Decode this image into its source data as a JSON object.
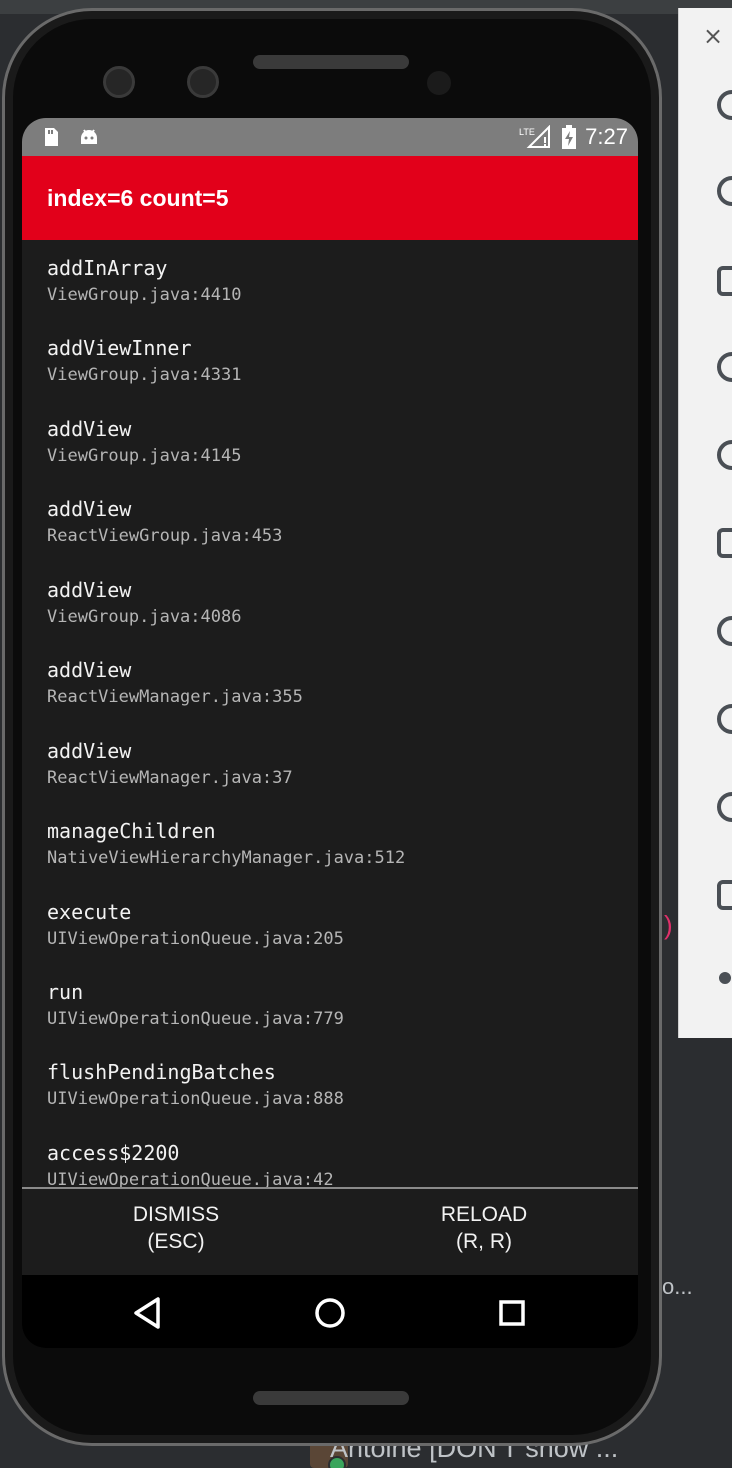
{
  "status_bar": {
    "network_label": "LTE",
    "time": "7:27"
  },
  "redbox": {
    "title": "index=6 count=5",
    "background_color": "#e2001a"
  },
  "stack_frames": [
    {
      "method": "addInArray",
      "file": "ViewGroup.java:4410"
    },
    {
      "method": "addViewInner",
      "file": "ViewGroup.java:4331"
    },
    {
      "method": "addView",
      "file": "ViewGroup.java:4145"
    },
    {
      "method": "addView",
      "file": "ReactViewGroup.java:453"
    },
    {
      "method": "addView",
      "file": "ViewGroup.java:4086"
    },
    {
      "method": "addView",
      "file": "ReactViewManager.java:355"
    },
    {
      "method": "addView",
      "file": "ReactViewManager.java:37"
    },
    {
      "method": "manageChildren",
      "file": "NativeViewHierarchyManager.java:512"
    },
    {
      "method": "execute",
      "file": "UIViewOperationQueue.java:205"
    },
    {
      "method": "run",
      "file": "UIViewOperationQueue.java:779"
    },
    {
      "method": "flushPendingBatches",
      "file": "UIViewOperationQueue.java:888"
    },
    {
      "method": "access$2200",
      "file": "UIViewOperationQueue.java:42"
    }
  ],
  "footer": {
    "dismiss_label": "DISMISS",
    "dismiss_shortcut": "(ESC)",
    "reload_label": "RELOAD",
    "reload_shortcut": "(R, R)"
  },
  "nav_bar": {
    "back_icon": "back-triangle-icon",
    "home_icon": "home-circle-icon",
    "recents_icon": "recents-square-icon"
  },
  "emulator_panel": {
    "close_glyph": "×"
  },
  "background_window": {
    "chat_text": "Antoine [DON'T show ...",
    "ellipsis": "o...",
    "accent_glyph": ")"
  }
}
